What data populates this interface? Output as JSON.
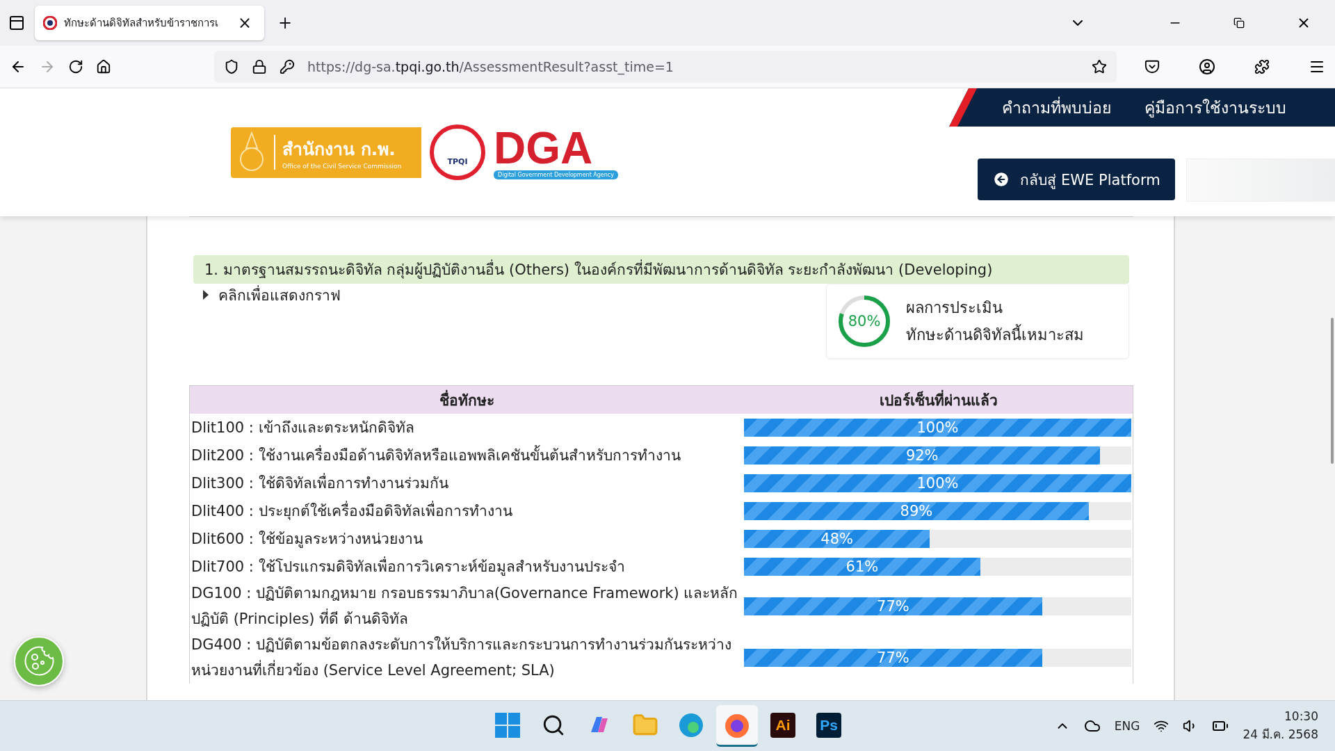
{
  "browser": {
    "tab": {
      "title": "ทักษะด้านดิจิทัลสำหรับข้าราชการเ",
      "selected": true,
      "close": "×"
    },
    "new_tab": "+",
    "url": {
      "prefix": "https://dg-sa.",
      "domain": "tpqi.go.th",
      "path": "/AssessmentResult?asst_time=1"
    }
  },
  "header": {
    "logo_ocsc": {
      "thai": "สำนักงาน ก.พ.",
      "english": "Office of the Civil Service Commission"
    },
    "logo_dga": {
      "name": "DGA",
      "subtitle": "Digital Government Development Agency",
      "seal": "TPQI"
    },
    "nav": [
      "คำถามที่พบบ่อย",
      "คู่มือการใช้งานระบบ"
    ],
    "back_button": "กลับสู่ EWE Platform"
  },
  "standard": {
    "title": "1. มาตรฐานสมรรถนะดิจิทัล กลุ่มผู้ปฏิบัติงานอื่น (Others) ในองค์กรที่มีพัฒนาการด้านดิจิทัล ระยะกำลังพัฒนา (Developing)",
    "graph_toggle": {
      "label": "คลิกเพื่อแสดงกราฟ",
      "expanded": false
    },
    "result": {
      "percent": "80%",
      "level": 0.8,
      "line_1": "ผลการประเมิน",
      "line_2": "ทักษะด้านดิจิทัลนี้เหมาะสม"
    }
  },
  "table": {
    "columns": [
      "ชื่อทักษะ",
      "เปอร์เซ็นที่ผ่านแล้ว"
    ],
    "rows": [
      {
        "skill": "Dlit100 : เข้าถึงและตระหนักดิจิทัล",
        "percent": "100%",
        "level": 1.0
      },
      {
        "skill": "Dlit200 : ใช้งานเครื่องมือด้านดิจิทัลหรือแอพพลิเคชันขั้นต้นสำหรับการทำงาน",
        "percent": "92%",
        "level": 0.92
      },
      {
        "skill": "Dlit300 : ใช้ดิจิทัลเพื่อการทำงานร่วมกัน",
        "percent": "100%",
        "level": 1.0
      },
      {
        "skill": "Dlit400 : ประยุกต์ใช้เครื่องมือดิจิทัลเพื่อการทำงาน",
        "percent": "89%",
        "level": 0.89
      },
      {
        "skill": "Dlit600 : ใช้ข้อมูลระหว่างหน่วยงาน",
        "percent": "48%",
        "level": 0.48
      },
      {
        "skill": "Dlit700 : ใช้โปรแกรมดิจิทัลเพื่อการวิเคราะห์ข้อมูลสำหรับงานประจำ",
        "percent": "61%",
        "level": 0.61
      },
      {
        "skill": "DG100 : ปฏิบัติตามกฎหมาย กรอบธรรมาภิบาล(Governance Framework) และหลักปฏิบัติ (Principles) ที่ดี ด้านดิจิทัล",
        "percent": "77%",
        "level": 0.77
      },
      {
        "skill": "DG400 : ปฏิบัติตามข้อตกลงระดับการให้บริการและกระบวนการทำงานร่วมกันระหว่างหน่วยงานที่เกี่ยวข้อง (Service Level Agreement; SLA)",
        "percent": "77%",
        "level": 0.77
      }
    ]
  },
  "taskbar": {
    "apps": [
      {
        "kind": "start",
        "selected": false
      },
      {
        "kind": "search",
        "selected": false
      },
      {
        "kind": "copilot",
        "selected": false
      },
      {
        "kind": "files",
        "selected": false
      },
      {
        "kind": "edge",
        "selected": false
      },
      {
        "kind": "firefox",
        "selected": true
      },
      {
        "kind": "ai",
        "label": "Ai",
        "selected": false
      },
      {
        "kind": "ps",
        "label": "Ps",
        "selected": false
      }
    ],
    "language": "ENG",
    "time": "10:30",
    "date": "24 มี.ค. 2568"
  }
}
